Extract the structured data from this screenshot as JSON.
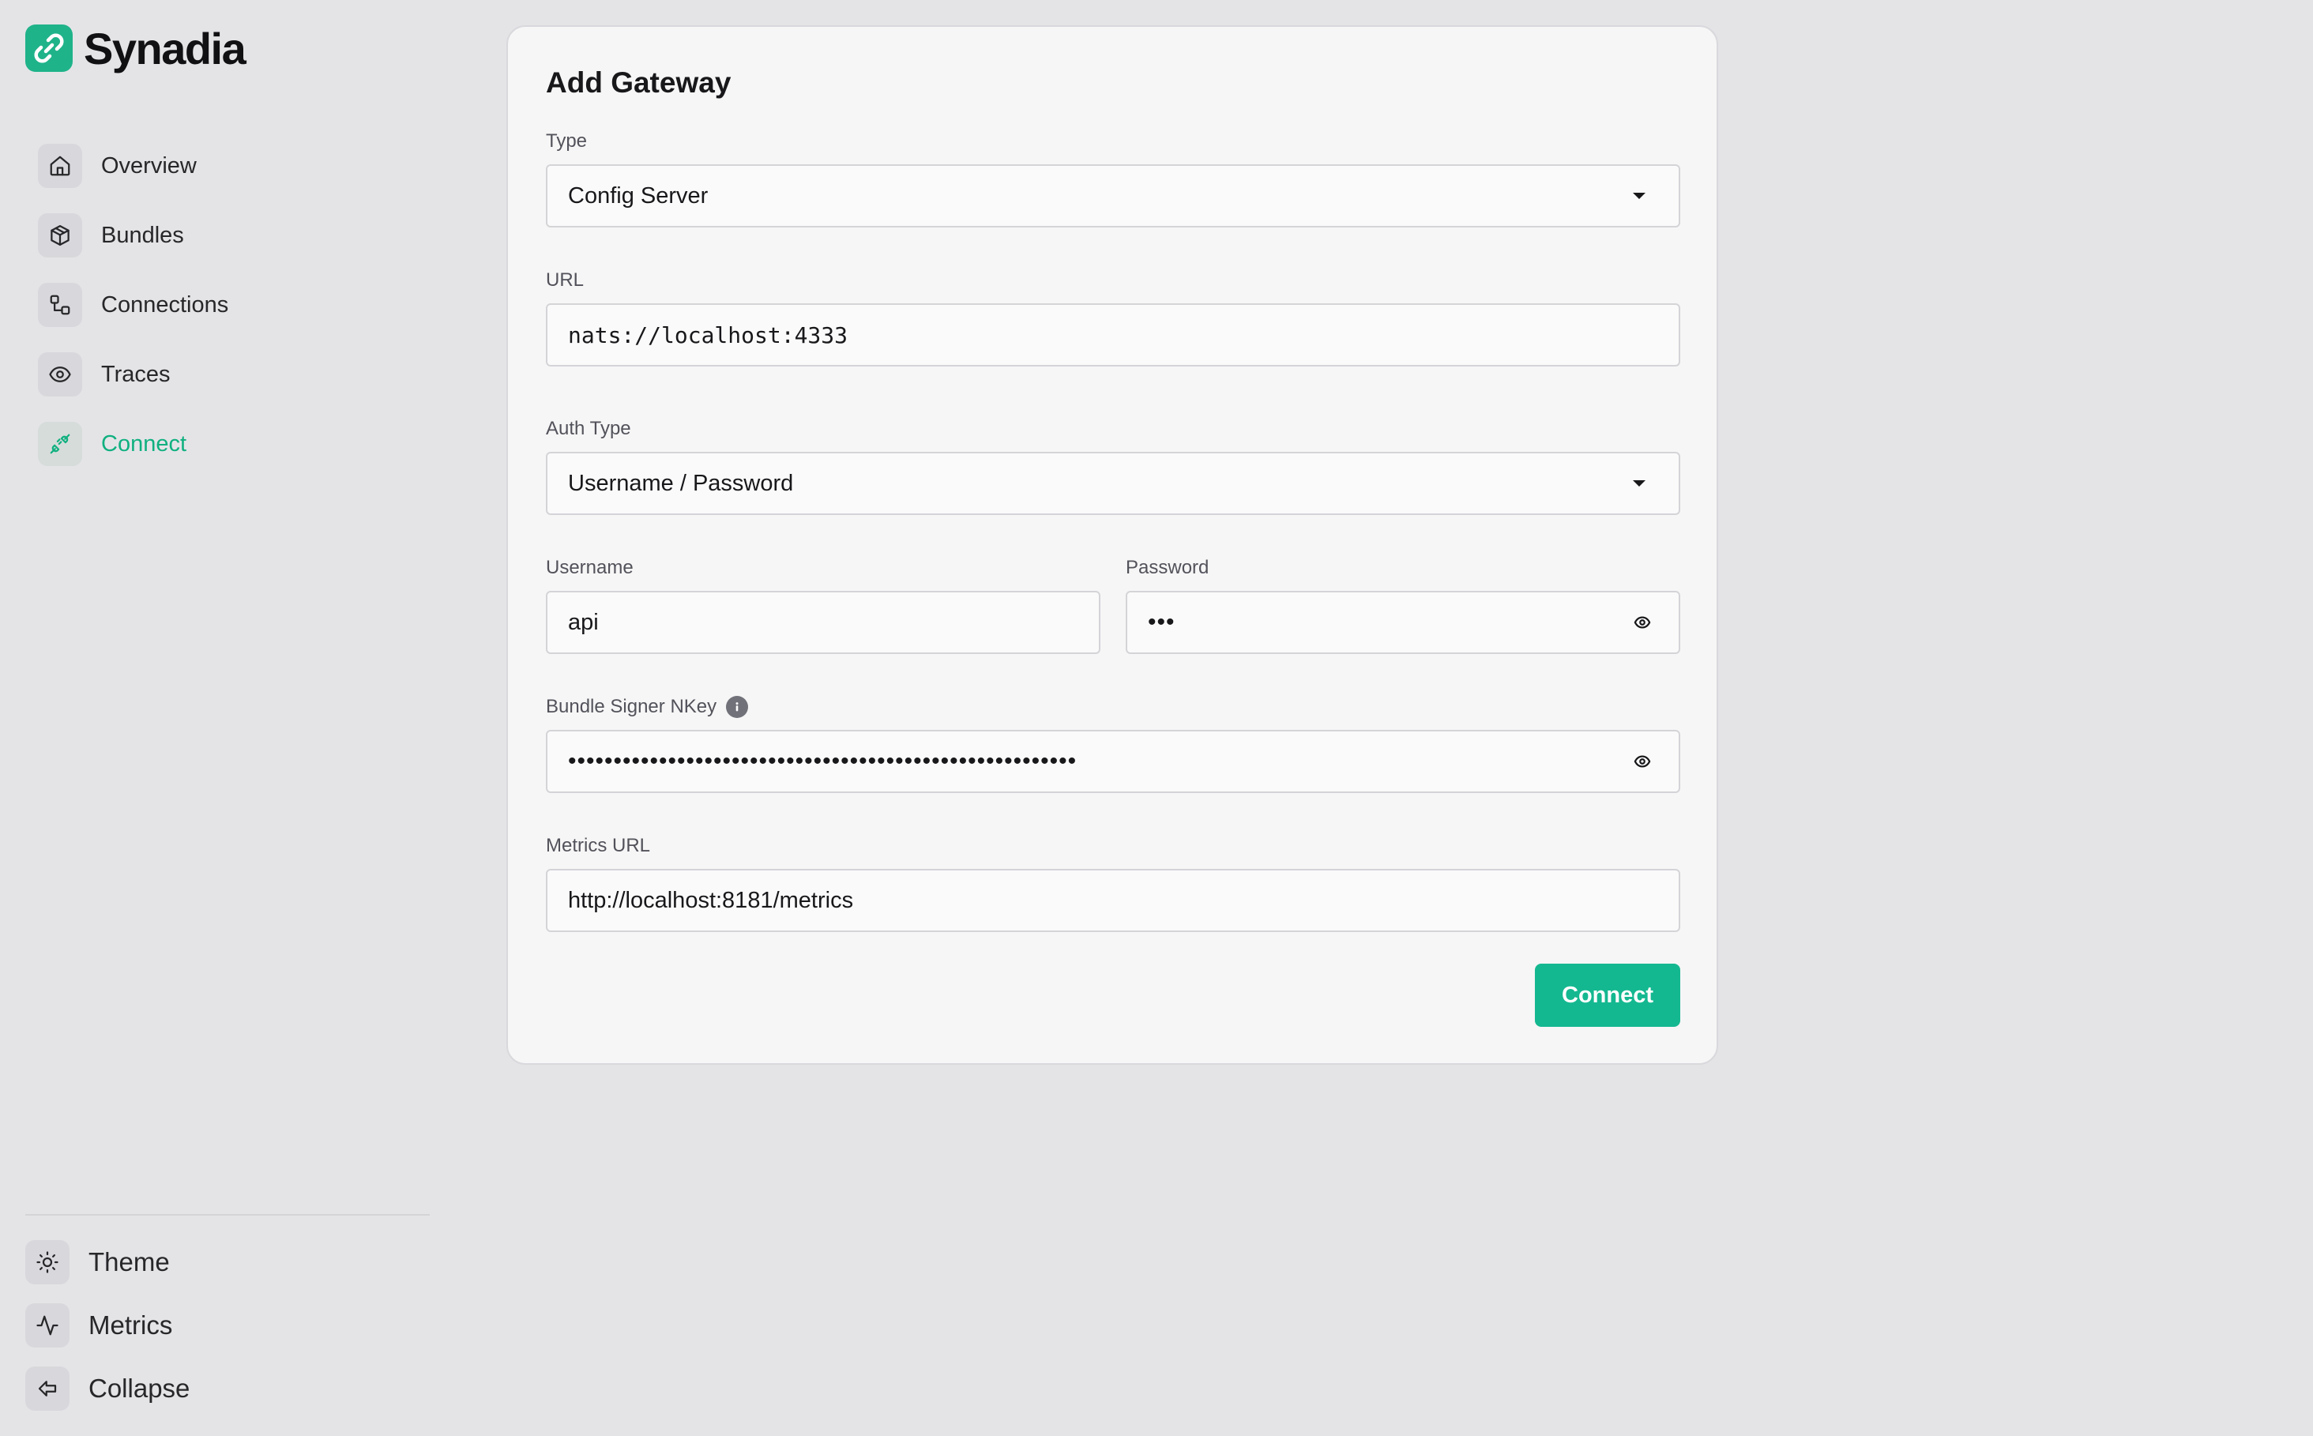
{
  "app": {
    "brand": "Synadia",
    "brand_color": "#1fb38a"
  },
  "sidebar": {
    "items": [
      {
        "label": "Overview",
        "icon": "home-icon"
      },
      {
        "label": "Bundles",
        "icon": "package-icon"
      },
      {
        "label": "Connections",
        "icon": "connections-icon"
      },
      {
        "label": "Traces",
        "icon": "eye-icon"
      },
      {
        "label": "Connect",
        "icon": "plug-icon",
        "active": true
      }
    ],
    "bottom_items": [
      {
        "label": "Theme",
        "icon": "sun-icon"
      },
      {
        "label": "Metrics",
        "icon": "activity-icon"
      },
      {
        "label": "Collapse",
        "icon": "arrow-left-icon"
      }
    ],
    "active_color": "#10b07f"
  },
  "form": {
    "title": "Add Gateway",
    "type": {
      "label": "Type",
      "value": "Config Server"
    },
    "url": {
      "label": "URL",
      "value": "nats://localhost:4333"
    },
    "auth_type": {
      "label": "Auth Type",
      "value": "Username / Password"
    },
    "username": {
      "label": "Username",
      "value": "api"
    },
    "password": {
      "label": "Password",
      "masked_value": "•••"
    },
    "bundle_signer_nkey": {
      "label": "Bundle Signer NKey",
      "masked_value": "••••••••••••••••••••••••••••••••••••••••••••••••••••••••"
    },
    "metrics_url": {
      "label": "Metrics URL",
      "value": "http://localhost:8181/metrics"
    },
    "submit_label": "Connect",
    "submit_color": "#14b890"
  }
}
